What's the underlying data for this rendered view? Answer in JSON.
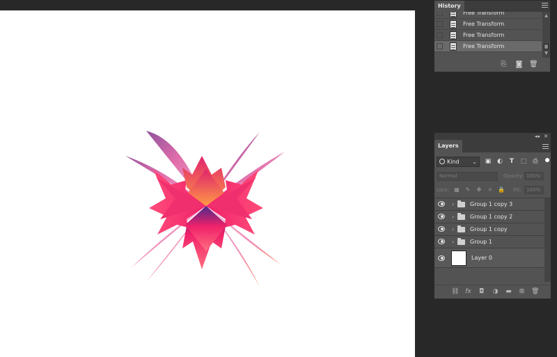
{
  "history": {
    "tab_label": "History",
    "items": [
      {
        "label": "Free Transform"
      },
      {
        "label": "Free Transform"
      },
      {
        "label": "Free Transform"
      },
      {
        "label": "Free Transform",
        "selected": true
      }
    ],
    "footer_icons": [
      "new-document-from-state-icon",
      "camera-snapshot-icon",
      "trash-icon"
    ]
  },
  "layers": {
    "tab_label": "Layers",
    "filter_kind": "Kind",
    "filter_icons": [
      "pixel-filter-icon",
      "adjustment-filter-icon",
      "type-filter-icon",
      "shape-filter-icon",
      "smart-object-filter-icon"
    ],
    "blend_mode": "Normal",
    "opacity_label": "Opacity:",
    "opacity_value": "100%",
    "lock_label": "Lock:",
    "fill_label": "Fill:",
    "fill_value": "100%",
    "items": [
      {
        "name": "Group 1 copy 3",
        "type": "group"
      },
      {
        "name": "Group 1 copy 2",
        "type": "group"
      },
      {
        "name": "Group 1 copy",
        "type": "group"
      },
      {
        "name": "Group 1",
        "type": "group"
      },
      {
        "name": "Layer 0",
        "type": "pixel"
      }
    ],
    "footer_icons": [
      "link-layers-icon",
      "fx-icon",
      "mask-icon",
      "adjustment-layer-icon",
      "new-group-icon",
      "new-layer-icon",
      "trash-icon"
    ]
  },
  "colors": {
    "workspace_bg": "#282828",
    "panel_bg": "#535353",
    "artwork_magenta": "#f0216a",
    "artwork_purple": "#5a2a86",
    "artwork_orange": "#ff8a3d",
    "artwork_pink": "#eaa0c8"
  }
}
